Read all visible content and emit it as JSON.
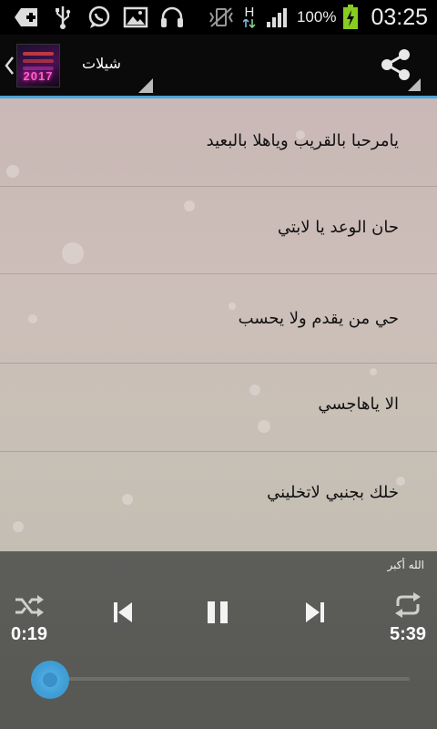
{
  "status_bar": {
    "battery_percent_label": "100%",
    "clock": "03:25",
    "network_type": "H",
    "icons": [
      "add-notification-icon",
      "usb-icon",
      "whatsapp-icon",
      "gallery-icon",
      "headset-icon",
      "vibrate-icon",
      "network-type-icon",
      "signal-icon",
      "battery-charging-icon"
    ]
  },
  "action_bar": {
    "title": "شيلات",
    "logo_text": "2017",
    "icons": [
      "back-chevron-icon",
      "share-icon"
    ]
  },
  "tracks": [
    {
      "title": "يامرحبا بالقريب وياهلا بالبعيد"
    },
    {
      "title": "حان الوعد يا لابتي"
    },
    {
      "title": "حي من يقدم ولا يحسب"
    },
    {
      "title": "الا ياهاجسي"
    },
    {
      "title": "خلك بجنبي لاتخليني"
    }
  ],
  "player": {
    "now_playing": "الله أكبر",
    "current_time": "0:19",
    "total_time": "5:39",
    "progress_fraction": 0.06,
    "icons": [
      "shuffle-icon",
      "previous-icon",
      "pause-icon",
      "next-icon",
      "repeat-icon"
    ]
  },
  "colors": {
    "accent": "#4aa5d8",
    "content_bg": "#c9b8b5",
    "player_bg": "#5b5b58"
  }
}
